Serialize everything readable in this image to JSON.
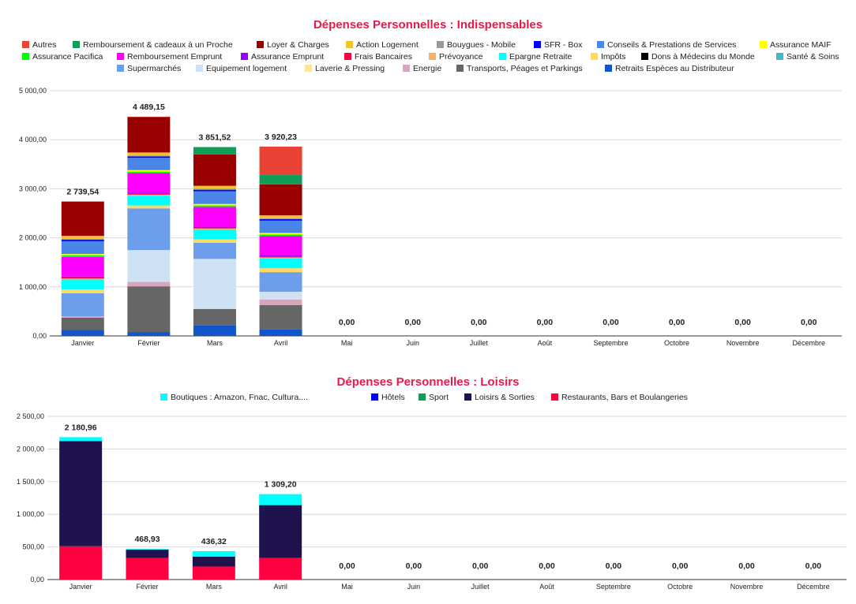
{
  "chart_data": [
    {
      "type": "bar",
      "stacked": true,
      "title": "Dépenses Personnelles : Indispensables",
      "categories": [
        "Janvier",
        "Février",
        "Mars",
        "Avril",
        "Mai",
        "Juin",
        "Juillet",
        "Août",
        "Septembre",
        "Octobre",
        "Novembre",
        "Décembre"
      ],
      "ylim": [
        0,
        5000
      ],
      "yticks": [
        "0,00",
        "1 000,00",
        "2 000,00",
        "3 000,00",
        "4 000,00",
        "5 000,00"
      ],
      "grid": true,
      "legend_position": "top",
      "totals": [
        "2 739,54",
        "4 489,15",
        "3 851,52",
        "3 920,23",
        "0,00",
        "0,00",
        "0,00",
        "0,00",
        "0,00",
        "0,00",
        "0,00",
        "0,00"
      ],
      "series": [
        {
          "name": "Retraits Espèces au Distributeur",
          "color": "#1155cc",
          "values": [
            120,
            80,
            220,
            130,
            0,
            0,
            0,
            0,
            0,
            0,
            0,
            0
          ]
        },
        {
          "name": "Transports, Péages et Parkings",
          "color": "#666666",
          "values": [
            250,
            930,
            330,
            500,
            0,
            0,
            0,
            0,
            0,
            0,
            0,
            0
          ]
        },
        {
          "name": "Energie",
          "color": "#d5a6bd",
          "values": [
            30,
            90,
            0,
            110,
            0,
            0,
            0,
            0,
            0,
            0,
            0,
            0
          ]
        },
        {
          "name": "Laverie & Pressing",
          "color": "#ffe599",
          "values": [
            0,
            0,
            0,
            0,
            0,
            0,
            0,
            0,
            0,
            0,
            0,
            0
          ]
        },
        {
          "name": "Equipement logement",
          "color": "#cfe2f3",
          "values": [
            0,
            650,
            1020,
            160,
            0,
            0,
            0,
            0,
            0,
            0,
            0,
            0
          ]
        },
        {
          "name": "Supermarchés",
          "color": "#6d9eeb",
          "values": [
            470,
            850,
            330,
            400,
            0,
            0,
            0,
            0,
            0,
            0,
            0,
            0
          ]
        },
        {
          "name": "Santé & Soins",
          "color": "#45b8c8",
          "values": [
            0,
            0,
            0,
            0,
            0,
            0,
            0,
            0,
            0,
            0,
            0,
            0
          ]
        },
        {
          "name": "Dons à Médecins du Monde",
          "color": "#000000",
          "values": [
            0,
            0,
            0,
            0,
            0,
            0,
            0,
            0,
            0,
            0,
            0,
            0
          ]
        },
        {
          "name": "Impôts",
          "color": "#ffd966",
          "values": [
            80,
            60,
            70,
            80,
            0,
            0,
            0,
            0,
            0,
            0,
            0,
            0
          ]
        },
        {
          "name": "Epargne Retraite",
          "color": "#00ffff",
          "values": [
            200,
            200,
            200,
            200,
            0,
            0,
            0,
            0,
            0,
            0,
            0,
            0
          ]
        },
        {
          "name": "Prévoyance",
          "color": "#f6b26b",
          "values": [
            20,
            20,
            20,
            20,
            0,
            0,
            0,
            0,
            0,
            0,
            0,
            0
          ]
        },
        {
          "name": "Frais Bancaires",
          "color": "#ff0040",
          "values": [
            20,
            20,
            20,
            20,
            0,
            0,
            0,
            0,
            0,
            0,
            0,
            0
          ]
        },
        {
          "name": "Assurance Emprunt",
          "color": "#9900ff",
          "values": [
            20,
            20,
            20,
            20,
            0,
            0,
            0,
            0,
            0,
            0,
            0,
            0
          ]
        },
        {
          "name": "Remboursement Emprunt",
          "color": "#ff00ff",
          "values": [
            400,
            400,
            400,
            400,
            0,
            0,
            0,
            0,
            0,
            0,
            0,
            0
          ]
        },
        {
          "name": "Assurance Pacifica",
          "color": "#00ff00",
          "values": [
            30,
            30,
            30,
            30,
            0,
            0,
            0,
            0,
            0,
            0,
            0,
            0
          ]
        },
        {
          "name": "Assurance MAIF",
          "color": "#ffff00",
          "values": [
            30,
            30,
            30,
            30,
            0,
            0,
            0,
            0,
            0,
            0,
            0,
            0
          ]
        },
        {
          "name": "Conseils & Prestations de Services",
          "color": "#4a86e8",
          "values": [
            260,
            250,
            260,
            250,
            0,
            0,
            0,
            0,
            0,
            0,
            0,
            0
          ]
        },
        {
          "name": "SFR - Box",
          "color": "#0000ff",
          "values": [
            30,
            30,
            30,
            30,
            0,
            0,
            0,
            0,
            0,
            0,
            0,
            0
          ]
        },
        {
          "name": "Bouygues - Mobile",
          "color": "#999999",
          "values": [
            20,
            20,
            20,
            20,
            0,
            0,
            0,
            0,
            0,
            0,
            0,
            0
          ]
        },
        {
          "name": "Action Logement",
          "color": "#f1c232",
          "values": [
            60,
            60,
            60,
            60,
            0,
            0,
            0,
            0,
            0,
            0,
            0,
            0
          ]
        },
        {
          "name": "Loyer & Charges",
          "color": "#990000",
          "values": [
            700,
            720,
            640,
            630,
            0,
            0,
            0,
            0,
            0,
            0,
            0,
            0
          ]
        },
        {
          "name": "Remboursement & cadeaux à un Proche",
          "color": "#0f9d58",
          "values": [
            0,
            0,
            150,
            200,
            0,
            0,
            0,
            0,
            0,
            0,
            0,
            0
          ]
        },
        {
          "name": "Autres",
          "color": "#ea4335",
          "values": [
            0,
            10,
            0,
            570,
            0,
            0,
            0,
            0,
            0,
            0,
            0,
            0
          ]
        }
      ]
    },
    {
      "type": "bar",
      "stacked": true,
      "title": "Dépenses Personnelles : Loisirs",
      "categories": [
        "Janvier",
        "Février",
        "Mars",
        "Avril",
        "Mai",
        "Juin",
        "Juillet",
        "Août",
        "Septembre",
        "Octobre",
        "Novembre",
        "Décembre"
      ],
      "ylim": [
        0,
        2500
      ],
      "yticks": [
        "0,00",
        "500,00",
        "1 000,00",
        "1 500,00",
        "2 000,00",
        "2 500,00"
      ],
      "grid": true,
      "legend_position": "top",
      "totals": [
        "2 180,96",
        "468,93",
        "436,32",
        "1 309,20",
        "0,00",
        "0,00",
        "0,00",
        "0,00",
        "0,00",
        "0,00",
        "0,00",
        "0,00"
      ],
      "series": [
        {
          "name": "Restaurants, Bars et Boulangeries",
          "color": "#ff0040",
          "values": [
            510,
            330,
            200,
            330,
            0,
            0,
            0,
            0,
            0,
            0,
            0,
            0
          ]
        },
        {
          "name": "Loisirs & Sorties",
          "color": "#20124d",
          "values": [
            1610,
            120,
            150,
            810,
            0,
            0,
            0,
            0,
            0,
            0,
            0,
            0
          ]
        },
        {
          "name": "Sport",
          "color": "#0f9d58",
          "values": [
            0,
            0,
            0,
            0,
            0,
            0,
            0,
            0,
            0,
            0,
            0,
            0
          ]
        },
        {
          "name": "Hôtels",
          "color": "#0000ff",
          "values": [
            0,
            10,
            0,
            0,
            0,
            0,
            0,
            0,
            0,
            0,
            0,
            0
          ]
        },
        {
          "name": "Boutiques : Amazon, Fnac, Cultura....",
          "color": "#00ffff",
          "values": [
            61,
            9,
            86,
            169,
            0,
            0,
            0,
            0,
            0,
            0,
            0,
            0
          ]
        }
      ]
    }
  ]
}
